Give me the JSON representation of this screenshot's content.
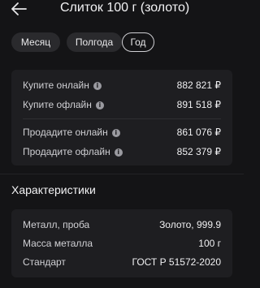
{
  "header": {
    "title": "Слиток 100 г (золото)"
  },
  "tabs": [
    {
      "label": "Месяц",
      "active": false
    },
    {
      "label": "Полгода",
      "active": false
    },
    {
      "label": "Год",
      "active": true
    }
  ],
  "prices": {
    "buy_online": {
      "label": "Купите онлайн",
      "value": "882 821 ₽"
    },
    "buy_offline": {
      "label": "Купите офлайн",
      "value": "891 518 ₽"
    },
    "sell_online": {
      "label": "Продадите онлайн",
      "value": "861 076 ₽"
    },
    "sell_offline": {
      "label": "Продадите офлайн",
      "value": "852 379 ₽"
    }
  },
  "specs": {
    "title": "Характеристики",
    "rows": [
      {
        "label": "Металл, проба",
        "value": "Золото, 999.9"
      },
      {
        "label": "Масса металла",
        "value": "100 г"
      },
      {
        "label": "Стандарт",
        "value": "ГОСТ Р 51572-2020"
      }
    ]
  },
  "icons": {
    "back": "arrow-left-icon",
    "info": "info-icon"
  }
}
